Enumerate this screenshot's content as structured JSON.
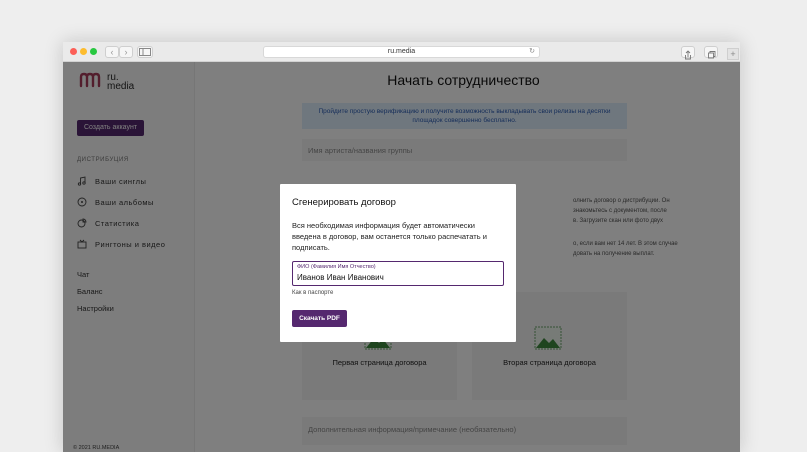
{
  "browser": {
    "url": "ru.media",
    "back_icon": "‹",
    "forward_icon": "›",
    "reload_icon": "↻",
    "new_tab_icon": "+"
  },
  "sidebar": {
    "logo_mark": "ꟽ",
    "logo_text_line1": "ru.",
    "logo_text_line2": "media",
    "create_account": "Создать аккаунт",
    "section_label": "ДИСТРИБУЦИЯ",
    "nav_items": [
      {
        "label": "Ваши синглы",
        "icon": "music-note-icon"
      },
      {
        "label": "Ваши альбомы",
        "icon": "disc-icon"
      },
      {
        "label": "Статистика",
        "icon": "chart-icon"
      },
      {
        "label": "Рингтоны и видео",
        "icon": "video-icon"
      }
    ],
    "links": [
      "Чат",
      "Баланс",
      "Настройки"
    ],
    "copyright": "© 2021 RU.MEDIA"
  },
  "main": {
    "title": "Начать сотрудничество",
    "banner_line1": "Пройдите простую верификацию и получите возможность выкладывать свои релизы на десятки",
    "banner_line2": "площадок совершенно бесплатно.",
    "artist_field_placeholder": "Имя артиста/названия группы",
    "bg_text_1": "олнить договор о дистрибуции. Он",
    "bg_text_2": "знакомьтесь с документом, после",
    "bg_text_3": "в. Загрузите скан или фото двух",
    "bg_text_4": "о, если вам нет 14 лет. В этом случае",
    "bg_text_5": "довать на получение выплат.",
    "card1_title": "Первая страница договора",
    "card2_title": "Вторая страница договора",
    "notes_placeholder": "Дополнительная информация/примечание (необязательно)"
  },
  "modal": {
    "title": "Сгенерировать договор",
    "text": "Вся необходимая информация будет автоматически введена в договор, вам останется только распечатать и подписать.",
    "fio_label": "ФИО (Фамилия Имя Отчество)",
    "fio_value": "Иванов Иван Иванович",
    "hint": "Как в паспорте",
    "download_button": "Скачать PDF"
  },
  "colors": {
    "accent": "#55286f",
    "banner_bg": "#dfeefd",
    "banner_text": "#2c5db3",
    "logo": "#a63c5a"
  }
}
